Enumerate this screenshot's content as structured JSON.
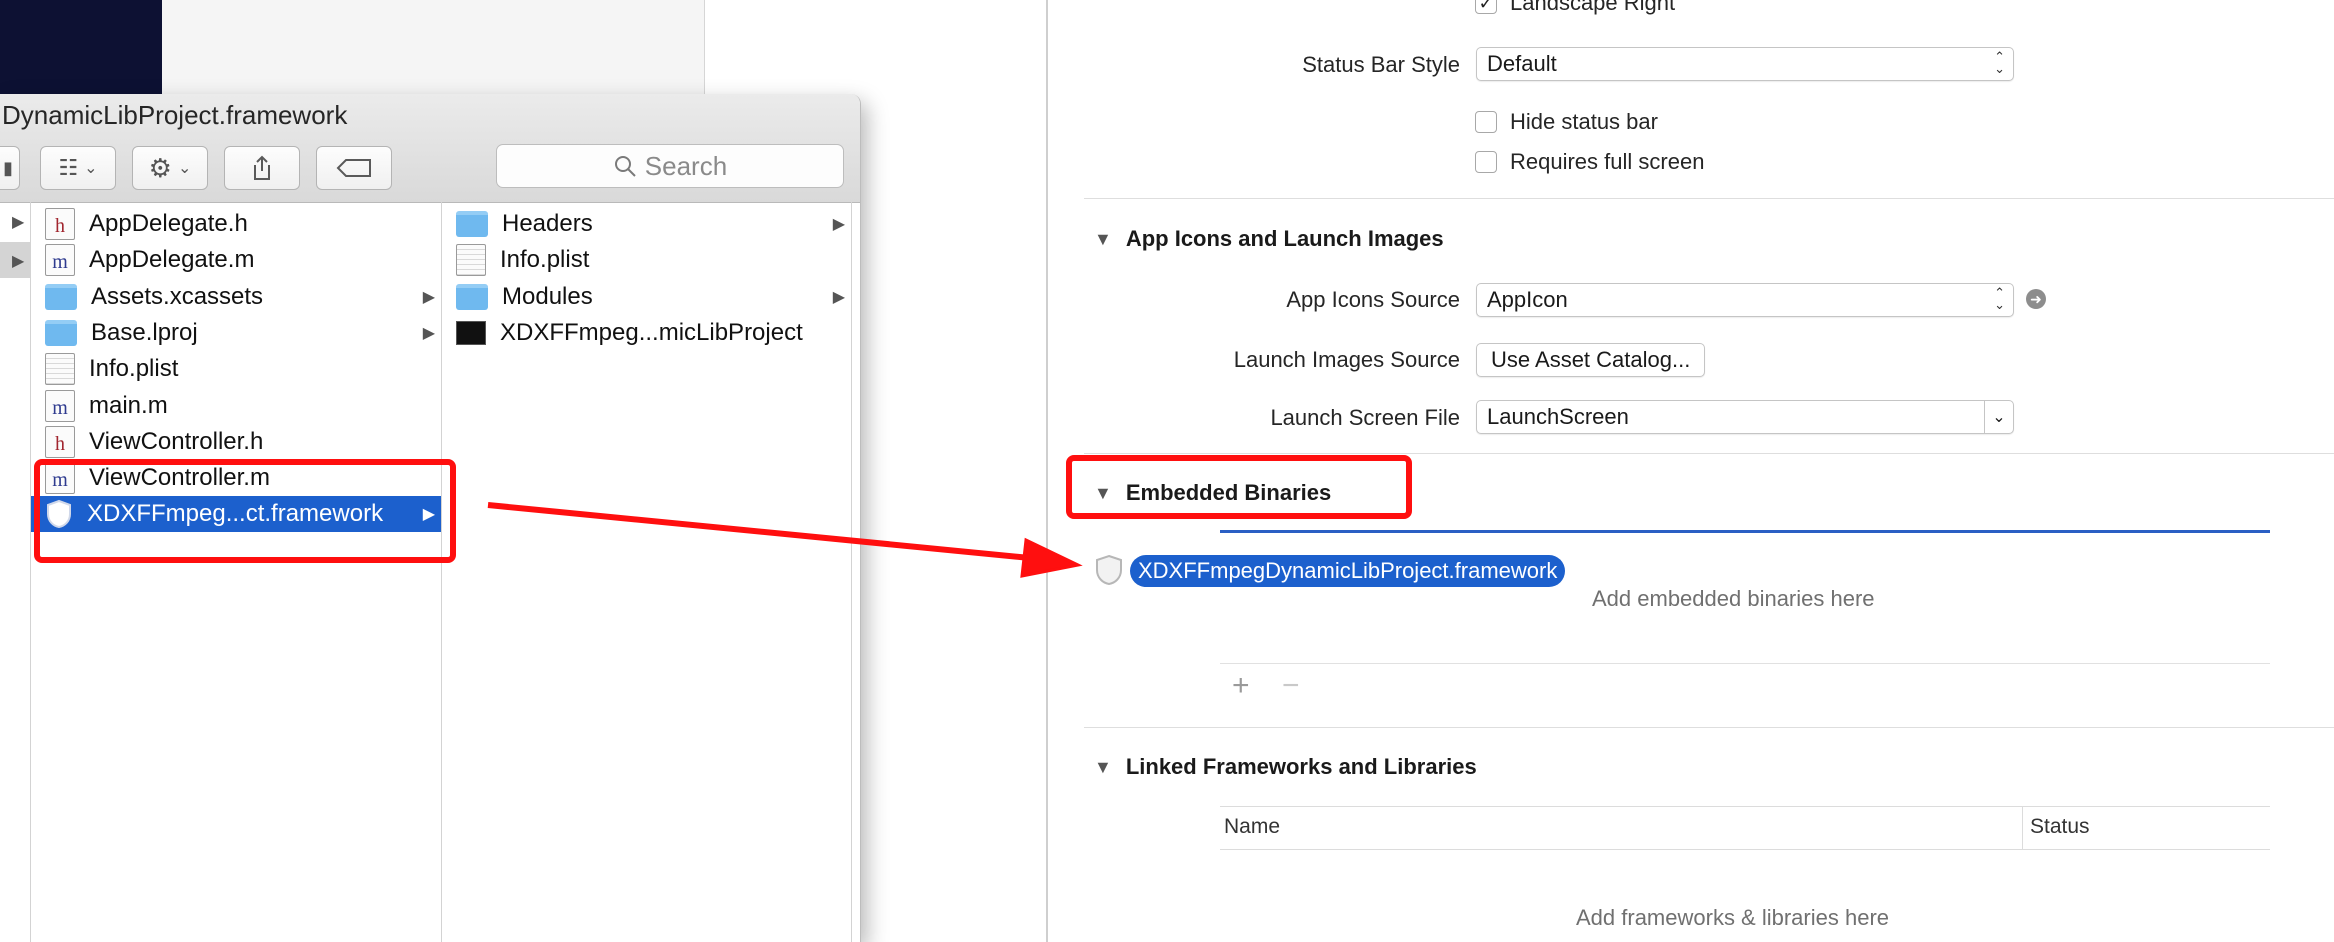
{
  "finder": {
    "title": "DynamicLibProject.framework",
    "search_placeholder": "Search",
    "column1": [
      {
        "name": "AppDelegate.h",
        "icon": "header-file-icon",
        "kind": "h",
        "folder": false
      },
      {
        "name": "AppDelegate.m",
        "icon": "source-file-icon",
        "kind": "m",
        "folder": false
      },
      {
        "name": "Assets.xcassets",
        "icon": "folder-icon",
        "kind": "folder",
        "folder": true
      },
      {
        "name": "Base.lproj",
        "icon": "folder-icon",
        "kind": "folder",
        "folder": true
      },
      {
        "name": "Info.plist",
        "icon": "plist-file-icon",
        "kind": "plist",
        "folder": false
      },
      {
        "name": "main.m",
        "icon": "source-file-icon",
        "kind": "m",
        "folder": false
      },
      {
        "name": "ViewController.h",
        "icon": "header-file-icon",
        "kind": "h",
        "folder": false
      },
      {
        "name": "ViewController.m",
        "icon": "source-file-icon",
        "kind": "m",
        "folder": false
      },
      {
        "name": "XDXFFmpeg...ct.framework",
        "icon": "framework-shield-icon",
        "kind": "framework",
        "folder": true,
        "selected": true
      }
    ],
    "column2": [
      {
        "name": "Headers",
        "icon": "folder-icon",
        "kind": "folder",
        "folder": true
      },
      {
        "name": "Info.plist",
        "icon": "plist-file-icon",
        "kind": "plist",
        "folder": false
      },
      {
        "name": "Modules",
        "icon": "folder-icon",
        "kind": "folder",
        "folder": true
      },
      {
        "name": "XDXFFmpeg...micLibProject",
        "icon": "executable-icon",
        "kind": "exec",
        "folder": false
      }
    ]
  },
  "xcode": {
    "landscape_right_label": "Landscape Right",
    "status_bar_style": {
      "label": "Status Bar Style",
      "value": "Default"
    },
    "hide_status_bar": "Hide status bar",
    "requires_full_screen": "Requires full screen",
    "app_icons_section": "App Icons and Launch Images",
    "app_icons_source": {
      "label": "App Icons Source",
      "value": "AppIcon"
    },
    "launch_images_source": {
      "label": "Launch Images Source",
      "button": "Use Asset Catalog..."
    },
    "launch_screen_file": {
      "label": "Launch Screen File",
      "value": "LaunchScreen"
    },
    "embedded_section": "Embedded Binaries",
    "dragged_item": "XDXFFmpegDynamicLibProject.framework",
    "embedded_placeholder": "Add embedded binaries here",
    "add_symbol": "+",
    "remove_symbol": "−",
    "linked_section": "Linked Frameworks and Libraries",
    "linked_columns": [
      "Name",
      "Status"
    ],
    "linked_placeholder": "Add frameworks & libraries here"
  },
  "colors": {
    "selection_blue": "#1c60cd",
    "annotation_red": "#ff0f0f",
    "folder_blue": "#6fb9ef"
  }
}
